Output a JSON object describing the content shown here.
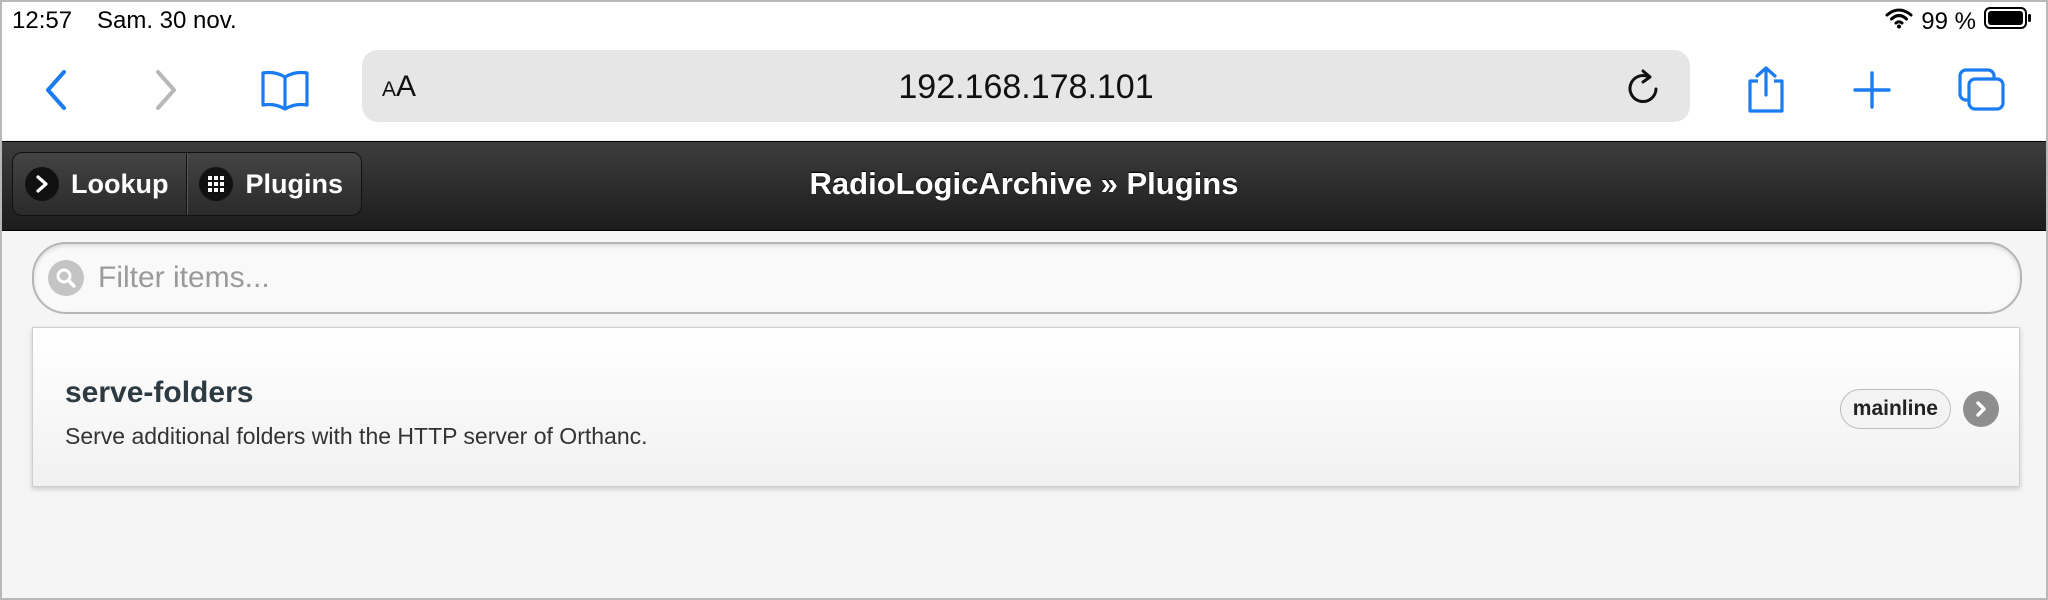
{
  "status_bar": {
    "time": "12:57",
    "date": "Sam. 30 nov.",
    "battery": "99 %",
    "icons": [
      "wifi-icon",
      "battery-icon"
    ]
  },
  "browser": {
    "text_size_label": "AA",
    "url": "192.168.178.101",
    "icons": [
      "back-icon",
      "forward-icon",
      "bookmarks-icon",
      "reload-icon",
      "share-icon",
      "new-tab-icon",
      "tabs-icon"
    ],
    "accent": "#1a7cf0"
  },
  "header": {
    "title": "RadioLogicArchive » Plugins",
    "buttons": [
      {
        "label": "Lookup",
        "icon": "chevron-right-icon"
      },
      {
        "label": "Plugins",
        "icon": "grid-icon"
      }
    ]
  },
  "filter": {
    "placeholder": "Filter items...",
    "value": ""
  },
  "plugins": [
    {
      "name": "serve-folders",
      "description": "Serve additional folders with the HTTP server of Orthanc.",
      "badge": "mainline"
    }
  ]
}
